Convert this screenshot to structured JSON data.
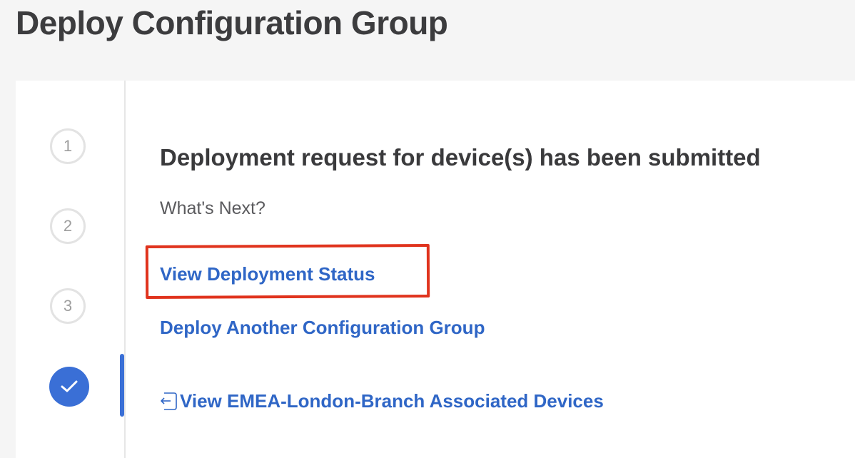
{
  "page": {
    "title": "Deploy Configuration Group"
  },
  "stepper": {
    "steps": [
      {
        "label": "1",
        "state": "pending"
      },
      {
        "label": "2",
        "state": "pending"
      },
      {
        "label": "3",
        "state": "pending"
      },
      {
        "label": "",
        "state": "complete",
        "icon": "checkmark-icon"
      }
    ],
    "active_color": "#3a6fd6"
  },
  "main": {
    "heading": "Deployment request for device(s) has been submitted",
    "subheading": "What's Next?",
    "links": {
      "view_status": "View Deployment Status",
      "deploy_another": "Deploy Another Configuration Group",
      "view_devices": "View EMEA-London-Branch Associated Devices"
    },
    "link_color": "#2f66c6",
    "highlight_color": "#e0331d"
  }
}
